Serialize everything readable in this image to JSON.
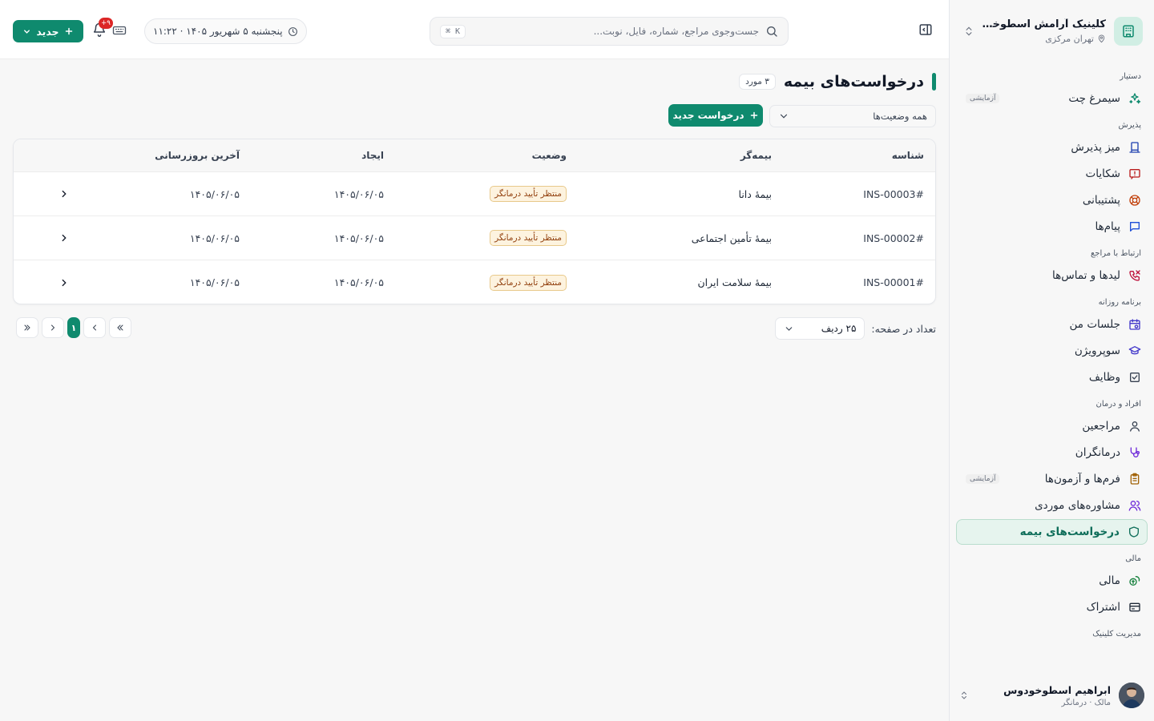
{
  "clinic": {
    "name": "کلینیک آرامش اسطوخو...",
    "location": "تهران مرکزی"
  },
  "nav": [
    {
      "section": "دستیار",
      "items": [
        {
          "label": "سیمرغ چت",
          "icon": "sparkles-icon",
          "tag": "آزمایشی"
        }
      ]
    },
    {
      "section": "پذیرش",
      "items": [
        {
          "label": "میز پذیرش",
          "icon": "reception-desk-icon"
        },
        {
          "label": "شکایات",
          "icon": "complaint-icon"
        },
        {
          "label": "پشتیبانی",
          "icon": "lifebuoy-icon"
        },
        {
          "label": "پیام‌ها",
          "icon": "message-icon"
        }
      ]
    },
    {
      "section": "ارتباط با مراجع",
      "items": [
        {
          "label": "لیدها و تماس‌ها",
          "icon": "phone-call-icon"
        }
      ]
    },
    {
      "section": "برنامه روزانه",
      "items": [
        {
          "label": "جلسات من",
          "icon": "calendar-icon"
        },
        {
          "label": "سوپرویژن",
          "icon": "graduation-cap-icon"
        },
        {
          "label": "وظایف",
          "icon": "checkbox-icon"
        }
      ]
    },
    {
      "section": "افراد و درمان",
      "items": [
        {
          "label": "مراجعین",
          "icon": "user-icon"
        },
        {
          "label": "درمانگران",
          "icon": "stethoscope-icon"
        },
        {
          "label": "فرم‌ها و آزمون‌ها",
          "icon": "clipboard-icon",
          "tag": "آزمایشی"
        },
        {
          "label": "مشاوره‌های موردی",
          "icon": "users-icon"
        },
        {
          "label": "درخواست‌های بیمه",
          "icon": "shield-icon",
          "active": true
        }
      ]
    },
    {
      "section": "مالی",
      "items": [
        {
          "label": "مالی",
          "icon": "coins-icon"
        },
        {
          "label": "اشتراک",
          "icon": "credit-card-icon"
        }
      ]
    },
    {
      "section": "مدیریت کلینیک",
      "items": []
    }
  ],
  "user": {
    "name": "ابراهیم اسطوخودوس",
    "role": "مالک · درمانگر"
  },
  "header": {
    "search_placeholder": "جست‌وجوی مراجع، شماره، فایل، نوبت...",
    "search_shortcut": "⌘ K",
    "datetime": "پنجشنبه ۵ شهریور ۱۴۰۵ · ۱۱:۲۲",
    "notifications": "۹+",
    "new_label": "جدید"
  },
  "page": {
    "title": "درخواست‌های بیمه",
    "count": "۳ مورد",
    "filter": "همه وضعیت‌ها",
    "add_label": "درخواست جدید"
  },
  "table": {
    "headers": {
      "id": "شناسه",
      "insurer": "بیمه‌گر",
      "status": "وضعیت",
      "created": "ایجاد",
      "updated": "آخرین بروزرسانی"
    },
    "rows": [
      {
        "id": "INS-00003#",
        "insurer": "بیمهٔ دانا",
        "status": "منتظر تأیید درمانگر",
        "created": "۱۴۰۵/۰۶/۰۵",
        "updated": "۱۴۰۵/۰۶/۰۵"
      },
      {
        "id": "INS-00002#",
        "insurer": "بیمهٔ تأمین اجتماعی",
        "status": "منتظر تأیید درمانگر",
        "created": "۱۴۰۵/۰۶/۰۵",
        "updated": "۱۴۰۵/۰۶/۰۵"
      },
      {
        "id": "INS-00001#",
        "insurer": "بیمهٔ سلامت ایران",
        "status": "منتظر تأیید درمانگر",
        "created": "۱۴۰۵/۰۶/۰۵",
        "updated": "۱۴۰۵/۰۶/۰۵"
      }
    ]
  },
  "pagination": {
    "per_page_label": "تعداد در صفحه:",
    "per_page_value": "۲۵ ردیف",
    "current_page": "۱"
  },
  "colors": {
    "accent": "#0f8a6e",
    "status_bg": "#fdf3df",
    "status_text": "#92400e",
    "badge": "#dc2626"
  }
}
